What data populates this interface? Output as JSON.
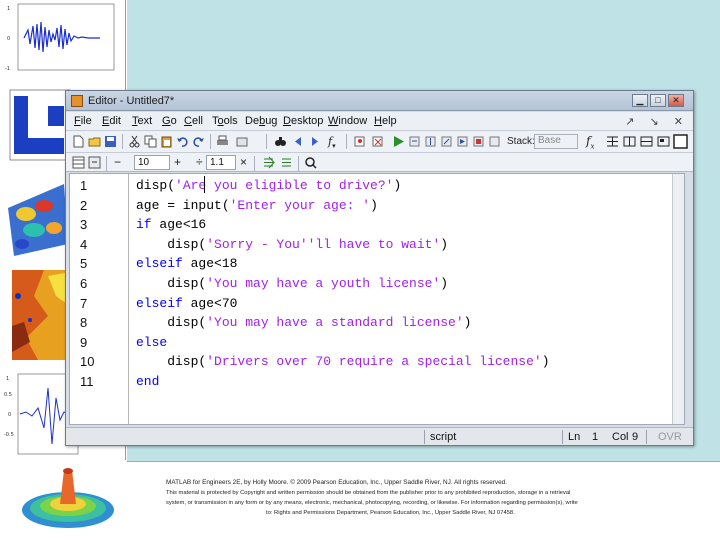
{
  "editor": {
    "title": "Editor - Untitled7*",
    "menu": [
      "File",
      "Edit",
      "Text",
      "Go",
      "Cell",
      "Tools",
      "Debug",
      "Desktop",
      "Window",
      "Help"
    ],
    "menu_underline": [
      "F",
      "E",
      "T",
      "G",
      "C",
      "o",
      "b",
      "D",
      "W",
      "H"
    ],
    "toolbar": {
      "stack_label": "Stack:",
      "stack_value": "Base",
      "cell_minus": "−",
      "cell_value_1": "10",
      "cell_plus": "+",
      "cell_divide": "÷",
      "cell_value_2": "1.1",
      "cell_times": "×"
    },
    "code_lines": [
      {
        "n": "1",
        "parts": [
          {
            "t": "disp(",
            "c": "plain"
          },
          {
            "t": "'Are you eligible to drive?'",
            "c": "str"
          },
          {
            "t": ")",
            "c": "plain"
          }
        ]
      },
      {
        "n": "2",
        "parts": [
          {
            "t": "age = input(",
            "c": "plain"
          },
          {
            "t": "'Enter your age: '",
            "c": "str"
          },
          {
            "t": ")",
            "c": "plain"
          }
        ]
      },
      {
        "n": "3",
        "parts": [
          {
            "t": "if",
            "c": "kw"
          },
          {
            "t": " age<16",
            "c": "plain"
          }
        ]
      },
      {
        "n": "4",
        "parts": [
          {
            "t": "    disp(",
            "c": "plain"
          },
          {
            "t": "'Sorry - You''ll have to wait'",
            "c": "str"
          },
          {
            "t": ")",
            "c": "plain"
          }
        ]
      },
      {
        "n": "5",
        "parts": [
          {
            "t": "elseif",
            "c": "kw"
          },
          {
            "t": " age<18",
            "c": "plain"
          }
        ]
      },
      {
        "n": "6",
        "parts": [
          {
            "t": "    disp(",
            "c": "plain"
          },
          {
            "t": "'You may have a youth license'",
            "c": "str"
          },
          {
            "t": ")",
            "c": "plain"
          }
        ]
      },
      {
        "n": "7",
        "parts": [
          {
            "t": "elseif",
            "c": "kw"
          },
          {
            "t": " age<70",
            "c": "plain"
          }
        ]
      },
      {
        "n": "8",
        "parts": [
          {
            "t": "    disp(",
            "c": "plain"
          },
          {
            "t": "'You may have a standard license'",
            "c": "str"
          },
          {
            "t": ")",
            "c": "plain"
          }
        ]
      },
      {
        "n": "9",
        "parts": [
          {
            "t": "else",
            "c": "kw"
          }
        ]
      },
      {
        "n": "10",
        "parts": [
          {
            "t": "    disp(",
            "c": "plain"
          },
          {
            "t": "'Drivers over 70 require a special license'",
            "c": "str"
          },
          {
            "t": ")",
            "c": "plain"
          }
        ]
      },
      {
        "n": "11",
        "parts": [
          {
            "t": "end",
            "c": "kw"
          }
        ]
      }
    ],
    "status": {
      "mode": "script",
      "ln_label": "Ln",
      "ln_value": "1",
      "col_label": "Col",
      "col_value": "9",
      "ovr": "OVR"
    }
  },
  "footer": {
    "line1": "MATLAB for Engineers 2E, by Holly Moore. © 2009 Pearson Education, Inc., Upper Saddle River, NJ. All rights reserved.",
    "line2": "This material is protected by Copyright and written permission should be obtained from the publisher prior to any prohibited reproduction, storage in a retrieval",
    "line3": "system, or transmission in any form or by any means, electronic, mechanical, photocopying, recording, or likewise. For information regarding permission(s), write",
    "line4": "to: Rights and Permissions Department, Pearson Education, Inc., Upper Saddle River, NJ 07458."
  },
  "colors": {
    "slide_bg": "#bfe2e6",
    "keyword": "#0000ff",
    "string": "#a020f0"
  },
  "icons": [
    "new-file-icon",
    "open-folder-icon",
    "save-icon",
    "cut-icon",
    "copy-icon",
    "paste-icon",
    "undo-icon",
    "redo-icon",
    "print-icon",
    "find-icon",
    "back-icon",
    "forward-icon",
    "function-icon",
    "breakpoint-icon",
    "run-icon",
    "step-icon",
    "fx-icon",
    "layout-icon",
    "cell-mode-icon",
    "eval-cell-icon",
    "close-window-icon"
  ]
}
